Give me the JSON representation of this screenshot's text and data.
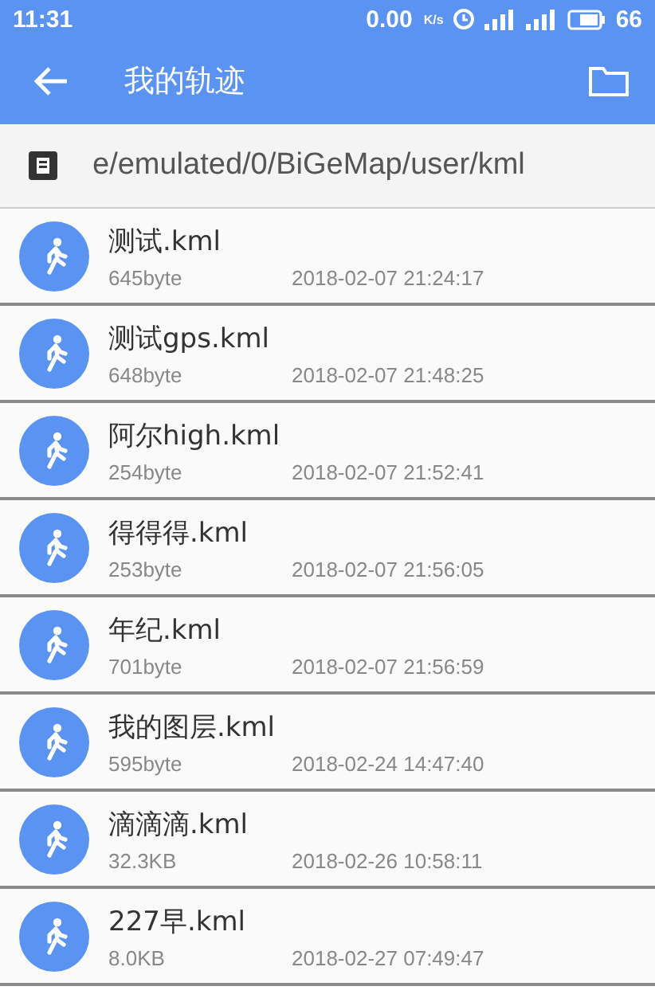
{
  "status_bar": {
    "time": "11:31",
    "speed": "0.00",
    "speed_unit": "K/s",
    "battery": "66"
  },
  "toolbar": {
    "title": "我的轨迹"
  },
  "path_bar": {
    "path": "e/emulated/0/BiGeMap/user/kml"
  },
  "files": [
    {
      "name": "测试.kml",
      "size": "645byte",
      "date": "2018-02-07 21:24:17"
    },
    {
      "name": "测试gps.kml",
      "size": "648byte",
      "date": "2018-02-07 21:48:25"
    },
    {
      "name": "阿尔high.kml",
      "size": "254byte",
      "date": "2018-02-07 21:52:41"
    },
    {
      "name": "得得得.kml",
      "size": "253byte",
      "date": "2018-02-07 21:56:05"
    },
    {
      "name": "年纪.kml",
      "size": "701byte",
      "date": "2018-02-07 21:56:59"
    },
    {
      "name": "我的图层.kml",
      "size": "595byte",
      "date": "2018-02-24 14:47:40"
    },
    {
      "name": "滴滴滴.kml",
      "size": "32.3KB",
      "date": "2018-02-26 10:58:11"
    },
    {
      "name": "227早.kml",
      "size": "8.0KB",
      "date": "2018-02-27 07:49:47"
    }
  ]
}
